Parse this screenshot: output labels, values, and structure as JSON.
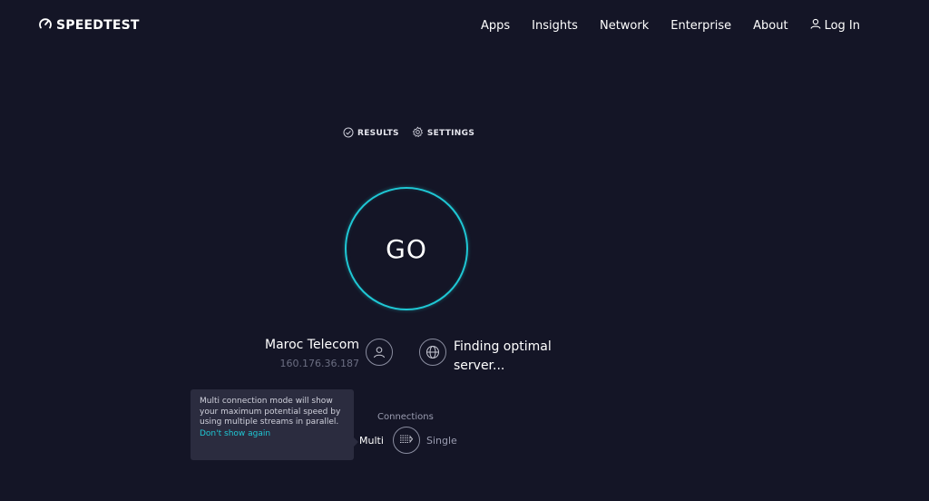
{
  "header": {
    "logo_text": "SPEEDTEST",
    "nav": [
      "Apps",
      "Insights",
      "Network",
      "Enterprise",
      "About"
    ],
    "login_label": "Log In"
  },
  "subnav": {
    "results_label": "RESULTS",
    "settings_label": "SETTINGS"
  },
  "go_button": {
    "label": "GO"
  },
  "isp": {
    "name": "Maroc Telecom",
    "ip": "160.176.36.187"
  },
  "server": {
    "status": "Finding optimal server..."
  },
  "tooltip": {
    "text": "Multi connection mode will show your maximum potential speed by using multiple streams in parallel.",
    "link": "Don't show again"
  },
  "connections": {
    "label": "Connections",
    "multi_label": "Multi",
    "single_label": "Single",
    "selected": "Multi"
  },
  "colors": {
    "background": "#141526",
    "accent": "#1fc7d4",
    "tooltip_bg": "#2b2c3f",
    "muted": "#6b6e82"
  },
  "icons": [
    "speedometer-icon",
    "user-icon",
    "check-circle-icon",
    "gear-icon",
    "globe-icon",
    "multi-connection-icon"
  ]
}
